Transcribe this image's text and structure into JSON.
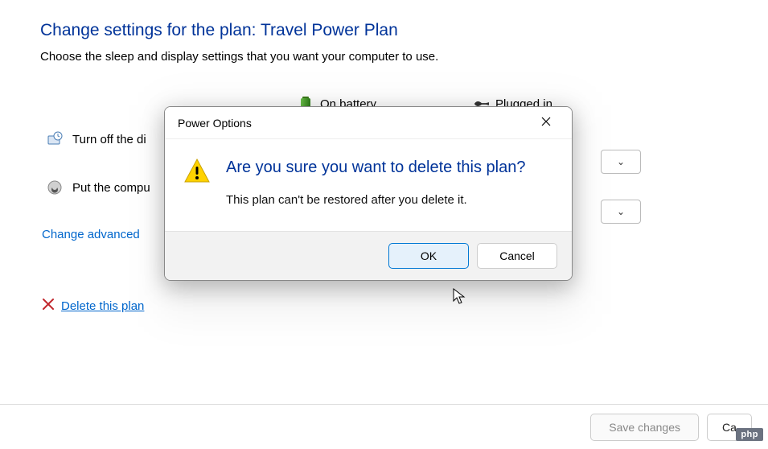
{
  "header": {
    "title_prefix": "Change settings for the plan: ",
    "plan_name": "Travel Power Plan",
    "subtitle": "Choose the sleep and display settings that you want your computer to use."
  },
  "columns": {
    "battery": "On battery",
    "plugged": "Plugged in"
  },
  "rows": {
    "display_label_visible": "Turn off the di",
    "sleep_label_visible": "Put the compu"
  },
  "links": {
    "advanced_visible": "Change advanced",
    "delete": "Delete this plan"
  },
  "buttons": {
    "save": "Save changes",
    "cancel_visible": "Ca"
  },
  "dialog": {
    "title": "Power Options",
    "heading": "Are you sure you want to delete this plan?",
    "body": "This plan can't be restored after you delete it.",
    "ok": "OK",
    "cancel": "Cancel"
  },
  "badge": "php"
}
